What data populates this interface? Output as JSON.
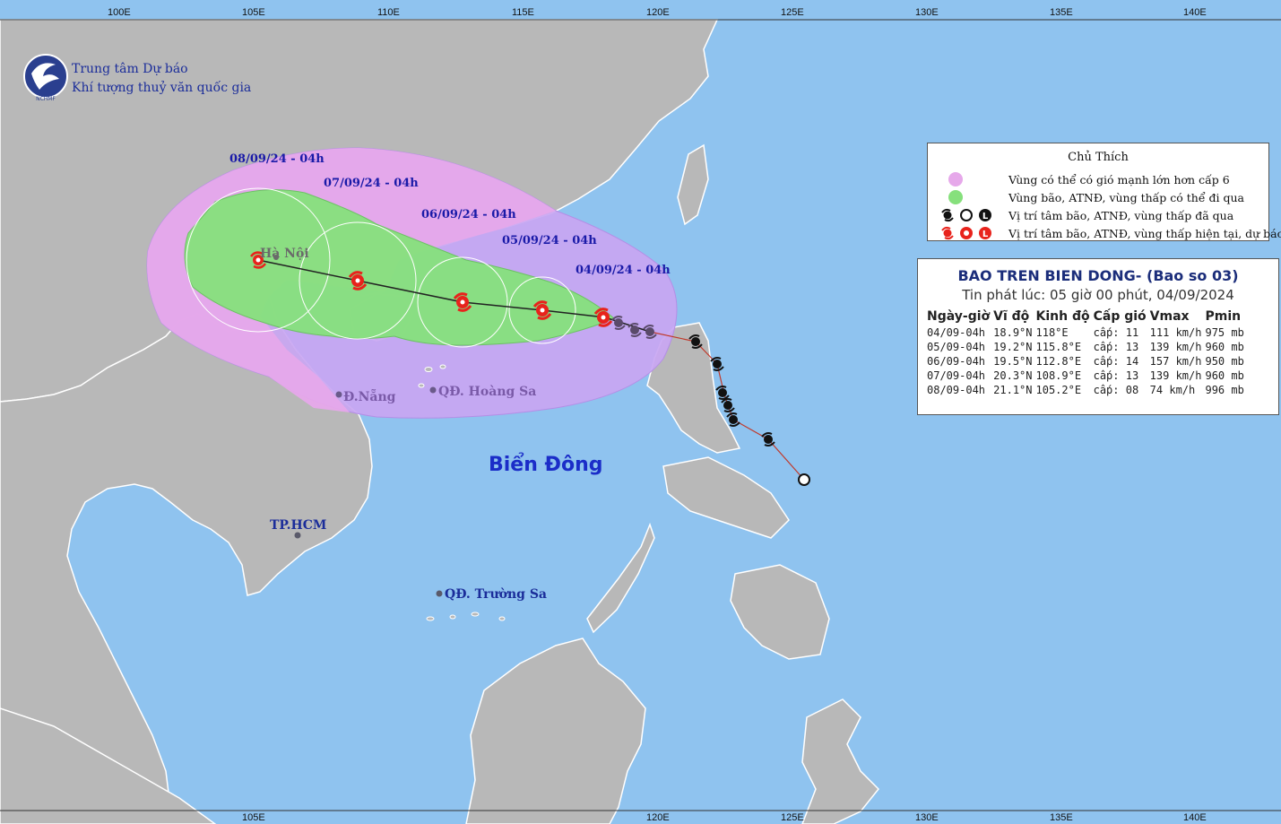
{
  "organization": {
    "name_line1": "Trung tâm Dự báo",
    "name_line2": "Khí tượng thuỷ văn quốc gia",
    "logo_text": "NCHMF"
  },
  "axes": {
    "top_labels": [
      "100E",
      "105E",
      "110E",
      "115E",
      "120E",
      "125E",
      "130E",
      "135E",
      "140E"
    ],
    "bottom_labels": [
      "105E",
      "120E",
      "125E",
      "130E",
      "135E",
      "140E"
    ]
  },
  "forecast_labels": [
    "08/09/24 - 04h",
    "07/09/24 - 04h",
    "06/09/24 - 04h",
    "05/09/24 - 04h",
    "04/09/24 - 04h"
  ],
  "places": {
    "hanoi": "Hà Nội",
    "danang": "Đ.Nẵng",
    "hoangsa": "QĐ. Hoàng Sa",
    "hcm": "TP.HCM",
    "truongsa": "QĐ. Trường Sa",
    "sea": "Biển Đông"
  },
  "legend": {
    "title": "Chủ Thích",
    "items": [
      {
        "text": "Vùng có thể có gió mạnh lớn hơn cấp 6",
        "color": "#e6a8ea"
      },
      {
        "text": "Vùng bão, ATNĐ, vùng thấp có thể đi qua",
        "color": "#86e07c"
      },
      {
        "text": "Vị trí tâm bão, ATNĐ, vùng thấp đã qua",
        "color": "#111111"
      },
      {
        "text": "Vị trí tâm bão, ATNĐ, vùng thấp hiện tại, dự báo",
        "color": "#e8231c"
      }
    ]
  },
  "bulletin": {
    "title": "BAO TREN BIEN DONG- (Bao so 03)",
    "issued": "Tin phát lúc: 05 giờ 00 phút, 04/09/2024",
    "headers": [
      "Ngày-giờ",
      "Vĩ độ",
      "Kinh độ",
      "Cấp gió",
      "Vmax",
      "Pmin"
    ],
    "rows": [
      [
        "04/09-04h",
        "18.9°N",
        "118°E",
        "cấp: 11",
        "111 km/h",
        "975 mb"
      ],
      [
        "05/09-04h",
        "19.2°N",
        "115.8°E",
        "cấp: 13",
        "139 km/h",
        "960 mb"
      ],
      [
        "06/09-04h",
        "19.5°N",
        "112.8°E",
        "cấp: 14",
        "157 km/h",
        "950 mb"
      ],
      [
        "07/09-04h",
        "20.3°N",
        "108.9°E",
        "cấp: 13",
        "139 km/h",
        "960 mb"
      ],
      [
        "08/09-04h",
        "21.1°N",
        "105.2°E",
        "cấp: 08",
        "74 km/h",
        "996 mb"
      ]
    ]
  },
  "colors": {
    "sea": "#8fc3ef",
    "land": "#b8b8b8",
    "wind_zone": "#e6a8ea",
    "track_zone": "#86e07c",
    "past_track": "#c0392b",
    "forecast_track": "#222222",
    "storm_current": "#e8231c",
    "storm_past": "#111111"
  }
}
